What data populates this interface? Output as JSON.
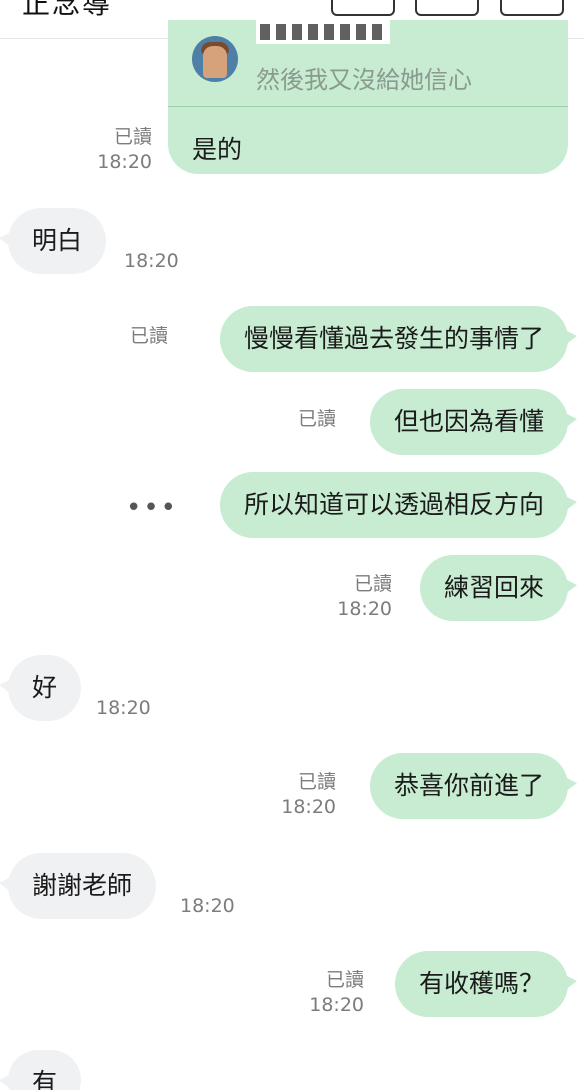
{
  "header": {
    "title": "正念導"
  },
  "reply": {
    "quoted_text": "然後我又沒給她信心",
    "text": "是的",
    "read": "已讀",
    "time": "18:20"
  },
  "messages": [
    {
      "side": "them",
      "text": "明白",
      "time": "18:20"
    },
    {
      "side": "me",
      "text": "慢慢看懂過去發生的事情了",
      "read": "已讀"
    },
    {
      "side": "me",
      "text": "但也因為看懂",
      "read": "已讀"
    },
    {
      "side": "me",
      "text": "所以知道可以透過相反方向",
      "more": "•••"
    },
    {
      "side": "me",
      "text": "練習回來",
      "read": "已讀",
      "time": "18:20"
    },
    {
      "side": "them",
      "text": "好",
      "time": "18:20"
    },
    {
      "side": "me",
      "text": "恭喜你前進了",
      "read": "已讀",
      "time": "18:20"
    },
    {
      "side": "them",
      "text": "謝謝老師",
      "time": "18:20"
    },
    {
      "side": "me",
      "text": "有收穫嗎？",
      "read": "已讀",
      "time": "18:20"
    },
    {
      "side": "them",
      "text": "有"
    }
  ],
  "colors": {
    "my_bubble": "#c7ecd1",
    "their_bubble": "#f0f1f3",
    "meta_text": "#7c7c7c"
  }
}
